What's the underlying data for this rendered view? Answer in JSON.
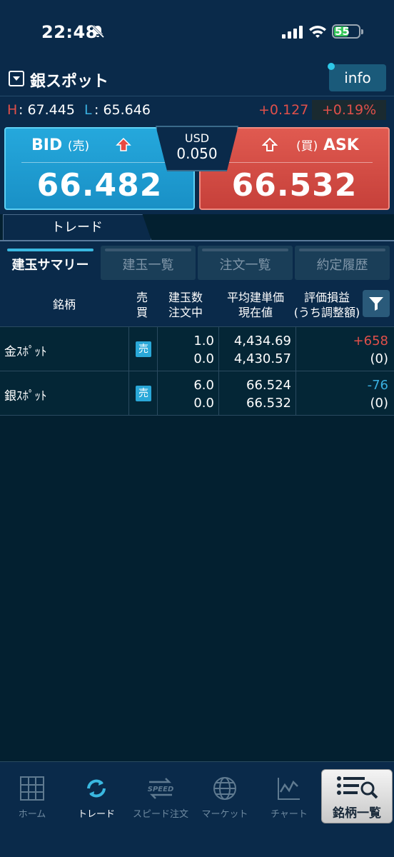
{
  "status": {
    "time": "22:48",
    "battery": "55"
  },
  "header": {
    "symbol": "銀スポット",
    "info_label": "info",
    "high_label": "H",
    "high_value": ": 67.445",
    "low_label": "L",
    "low_value": ": 65.646",
    "change": "+0.127",
    "change_pct": "+0.19%"
  },
  "quote": {
    "bid_label": "BID",
    "bid_paren": "(売)",
    "bid_price": "66.482",
    "ask_label": "ASK",
    "ask_paren": "(買)",
    "ask_price": "66.532",
    "spread_currency": "USD",
    "spread_value": "0.050"
  },
  "trade_tab": "トレード",
  "sub_tabs": [
    "建玉サマリー",
    "建玉一覧",
    "注文一覧",
    "約定履歴"
  ],
  "table": {
    "col_name": "銘柄",
    "col_side_1": "売",
    "col_side_2": "買",
    "col_qty_1": "建玉数",
    "col_qty_2": "注文中",
    "col_price_1": "平均建単価",
    "col_price_2": "現在値",
    "col_pl_1": "評価損益",
    "col_pl_2": "(うち調整額)",
    "rows": [
      {
        "name": "金ｽﾎﾟｯﾄ",
        "side": "売",
        "qty": "1.0",
        "ordered": "0.0",
        "avg_price": "4,434.69",
        "current": "4,430.57",
        "pl": "+658",
        "adj": "(0)",
        "pl_color": "#e0504a"
      },
      {
        "name": "銀ｽﾎﾟｯﾄ",
        "side": "売",
        "qty": "6.0",
        "ordered": "0.0",
        "avg_price": "66.524",
        "current": "66.532",
        "pl": "-76",
        "adj": "(0)",
        "pl_color": "#3ab0e0"
      }
    ]
  },
  "nav": {
    "home": "ホーム",
    "trade": "トレード",
    "speed": "スピード注文",
    "market": "マーケット",
    "chart": "チャート",
    "symbols": "銘柄一覧",
    "speed_icon_text": "SPEED"
  },
  "colors": {
    "up": "#e0504a",
    "down": "#3ab0e0",
    "accent": "#3ab8e0"
  }
}
